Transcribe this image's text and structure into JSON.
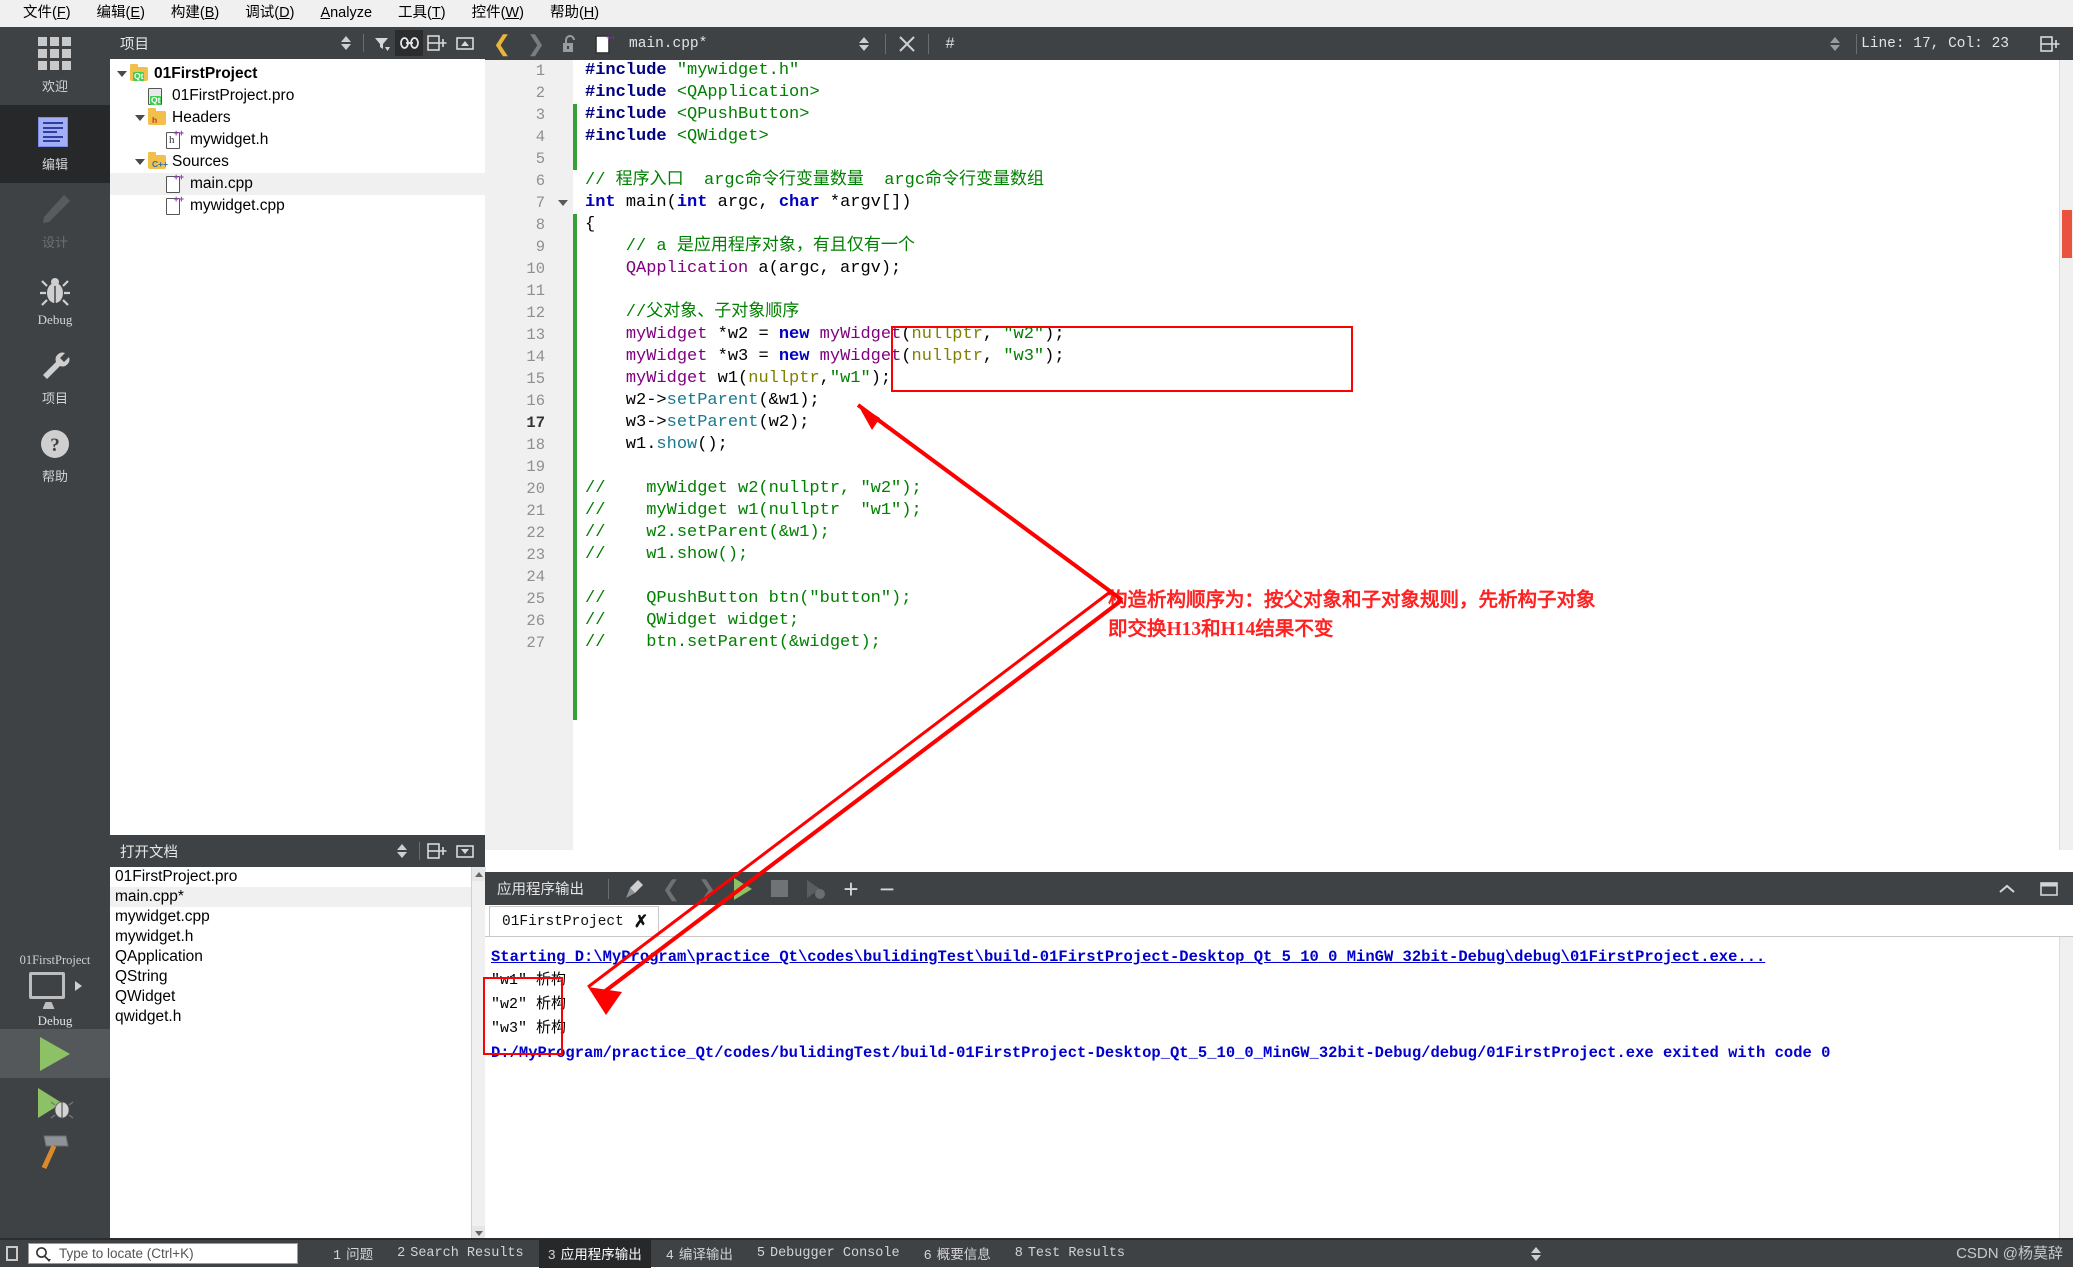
{
  "menu": {
    "items": [
      {
        "label": "文件(F)",
        "mnemonic": "F"
      },
      {
        "label": "编辑(E)",
        "mnemonic": "E"
      },
      {
        "label": "构建(B)",
        "mnemonic": "B"
      },
      {
        "label": "调试(D)",
        "mnemonic": "D"
      },
      {
        "label": "Analyze",
        "mnemonic": "A"
      },
      {
        "label": "工具(T)",
        "mnemonic": "T"
      },
      {
        "label": "控件(W)",
        "mnemonic": "W"
      },
      {
        "label": "帮助(H)",
        "mnemonic": "H"
      }
    ]
  },
  "modebar": {
    "items": [
      {
        "label": "欢迎",
        "icon": "grid-icon",
        "state": "normal"
      },
      {
        "label": "编辑",
        "icon": "edit-icon",
        "state": "selected"
      },
      {
        "label": "设计",
        "icon": "pencil-icon",
        "state": "disabled"
      },
      {
        "label": "Debug",
        "icon": "bug-icon",
        "state": "normal"
      },
      {
        "label": "项目",
        "icon": "wrench-icon",
        "state": "normal"
      },
      {
        "label": "帮助",
        "icon": "question-icon",
        "state": "normal"
      }
    ]
  },
  "project_panel": {
    "title": "项目",
    "toolbar_icons": [
      "sync-updown-icon",
      "filter-icon",
      "link-icon",
      "split-add-icon",
      "collapse-icon"
    ],
    "tree": [
      {
        "label": "01FirstProject",
        "indent": 0,
        "icon": "folder-qt-icon",
        "expander": "down",
        "bold": true,
        "selected": false
      },
      {
        "label": "01FirstProject.pro",
        "indent": 1,
        "icon": "file-qt-icon",
        "expander": "none",
        "bold": false,
        "selected": false
      },
      {
        "label": "Headers",
        "indent": 1,
        "icon": "folder-h-icon",
        "expander": "down",
        "bold": false,
        "selected": false
      },
      {
        "label": "mywidget.h",
        "indent": 2,
        "icon": "header-cpp-icon",
        "expander": "none",
        "bold": false,
        "selected": false
      },
      {
        "label": "Sources",
        "indent": 1,
        "icon": "folder-cpp-icon",
        "expander": "down",
        "bold": false,
        "selected": false
      },
      {
        "label": "main.cpp",
        "indent": 2,
        "icon": "source-cpp-icon",
        "expander": "none",
        "bold": false,
        "selected": true
      },
      {
        "label": "mywidget.cpp",
        "indent": 2,
        "icon": "source-cpp-icon",
        "expander": "none",
        "bold": false,
        "selected": false
      }
    ]
  },
  "docs_panel": {
    "title": "打开文档",
    "toolbar_icons": [
      "sync-updown-icon",
      "split-add-icon",
      "dropdown-icon"
    ],
    "items": [
      {
        "label": "01FirstProject.pro",
        "selected": false
      },
      {
        "label": "main.cpp*",
        "selected": true
      },
      {
        "label": "mywidget.cpp",
        "selected": false
      },
      {
        "label": "mywidget.h",
        "selected": false
      },
      {
        "label": "QApplication",
        "selected": false
      },
      {
        "label": "QString",
        "selected": false
      },
      {
        "label": "QWidget",
        "selected": false
      },
      {
        "label": "qwidget.h",
        "selected": false
      }
    ]
  },
  "kit_selector": {
    "project": "01FirstProject",
    "build_config": "Debug",
    "actions": [
      "run-button",
      "debug-button",
      "build-button"
    ]
  },
  "editor_toolbar": {
    "filename": "main.cpp*",
    "hash_symbol": "#",
    "line_col": "Line: 17, Col: 23",
    "icons": [
      "back-arrow-icon",
      "forward-arrow-icon",
      "unlock-icon",
      "file-cpp-icon",
      "updown-icon",
      "close-icon",
      "hash-icon",
      "split-add-icon"
    ]
  },
  "code": {
    "lines": [
      {
        "n": 1,
        "tokens": [
          {
            "t": "#include ",
            "c": "pp"
          },
          {
            "t": "\"mywidget.h\"",
            "c": "s"
          }
        ]
      },
      {
        "n": 2,
        "tokens": [
          {
            "t": "#include ",
            "c": "pp"
          },
          {
            "t": "<QApplication>",
            "c": "s"
          }
        ]
      },
      {
        "n": 3,
        "tokens": [
          {
            "t": "#include ",
            "c": "pp"
          },
          {
            "t": "<QPushButton>",
            "c": "s"
          }
        ]
      },
      {
        "n": 4,
        "tokens": [
          {
            "t": "#include ",
            "c": "pp"
          },
          {
            "t": "<QWidget>",
            "c": "s"
          }
        ]
      },
      {
        "n": 5,
        "tokens": []
      },
      {
        "n": 6,
        "tokens": [
          {
            "t": "// 程序入口  argc命令行变量数量  argc命令行变量数组",
            "c": "c"
          }
        ]
      },
      {
        "n": 7,
        "tokens": [
          {
            "t": "int",
            "c": "k"
          },
          {
            "t": " ",
            "c": "pl"
          },
          {
            "t": "main",
            "c": "pl"
          },
          {
            "t": "(",
            "c": "pl"
          },
          {
            "t": "int",
            "c": "k"
          },
          {
            "t": " argc, ",
            "c": "pl"
          },
          {
            "t": "char",
            "c": "k"
          },
          {
            "t": " *argv[])",
            "c": "pl"
          }
        ]
      },
      {
        "n": 8,
        "tokens": [
          {
            "t": "{",
            "c": "pl"
          }
        ]
      },
      {
        "n": 9,
        "tokens": [
          {
            "t": "    // a 是应用程序对象，有且仅有一个",
            "c": "c"
          }
        ]
      },
      {
        "n": 10,
        "tokens": [
          {
            "t": "    ",
            "c": "pl"
          },
          {
            "t": "QApplication",
            "c": "ty"
          },
          {
            "t": " a(argc, argv);",
            "c": "pl"
          }
        ]
      },
      {
        "n": 11,
        "tokens": []
      },
      {
        "n": 12,
        "tokens": [
          {
            "t": "    //父对象、子对象顺序",
            "c": "c"
          }
        ]
      },
      {
        "n": 13,
        "tokens": [
          {
            "t": "    ",
            "c": "pl"
          },
          {
            "t": "myWidget",
            "c": "ty"
          },
          {
            "t": " *w2 = ",
            "c": "pl"
          },
          {
            "t": "new",
            "c": "k"
          },
          {
            "t": " ",
            "c": "pl"
          },
          {
            "t": "myWidget",
            "c": "ty"
          },
          {
            "t": "(",
            "c": "pl"
          },
          {
            "t": "nullptr",
            "c": "np"
          },
          {
            "t": ", ",
            "c": "pl"
          },
          {
            "t": "\"w2\"",
            "c": "s"
          },
          {
            "t": ");",
            "c": "pl"
          }
        ]
      },
      {
        "n": 14,
        "tokens": [
          {
            "t": "    ",
            "c": "pl"
          },
          {
            "t": "myWidget",
            "c": "ty"
          },
          {
            "t": " *w3 = ",
            "c": "pl"
          },
          {
            "t": "new",
            "c": "k"
          },
          {
            "t": " ",
            "c": "pl"
          },
          {
            "t": "myWidget",
            "c": "ty"
          },
          {
            "t": "(",
            "c": "pl"
          },
          {
            "t": "nullptr",
            "c": "np"
          },
          {
            "t": ", ",
            "c": "pl"
          },
          {
            "t": "\"w3\"",
            "c": "s"
          },
          {
            "t": ");",
            "c": "pl"
          }
        ]
      },
      {
        "n": 15,
        "tokens": [
          {
            "t": "    ",
            "c": "pl"
          },
          {
            "t": "myWidget",
            "c": "ty"
          },
          {
            "t": " w1(",
            "c": "pl"
          },
          {
            "t": "nullptr",
            "c": "np"
          },
          {
            "t": ",",
            "c": "pl"
          },
          {
            "t": "\"w1\"",
            "c": "s"
          },
          {
            "t": ");",
            "c": "pl"
          }
        ]
      },
      {
        "n": 16,
        "tokens": [
          {
            "t": "    w2->",
            "c": "pl"
          },
          {
            "t": "setParent",
            "c": "fn"
          },
          {
            "t": "(&w1);",
            "c": "pl"
          }
        ]
      },
      {
        "n": 17,
        "tokens": [
          {
            "t": "    w3->",
            "c": "pl"
          },
          {
            "t": "setParent",
            "c": "fn"
          },
          {
            "t": "(w2);",
            "c": "pl"
          }
        ]
      },
      {
        "n": 18,
        "tokens": [
          {
            "t": "    w1.",
            "c": "pl"
          },
          {
            "t": "show",
            "c": "fn"
          },
          {
            "t": "();",
            "c": "pl"
          }
        ]
      },
      {
        "n": 19,
        "tokens": []
      },
      {
        "n": 20,
        "tokens": [
          {
            "t": "//    myWidget w2(nullptr, \"w2\");",
            "c": "c"
          }
        ]
      },
      {
        "n": 21,
        "tokens": [
          {
            "t": "//    myWidget w1(nullptr  \"w1\");",
            "c": "c"
          }
        ]
      },
      {
        "n": 22,
        "tokens": [
          {
            "t": "//    w2.setParent(&w1);",
            "c": "c"
          }
        ]
      },
      {
        "n": 23,
        "tokens": [
          {
            "t": "//    w1.show();",
            "c": "c"
          }
        ]
      },
      {
        "n": 24,
        "tokens": []
      },
      {
        "n": 25,
        "tokens": [
          {
            "t": "//    QPushButton btn(\"button\");",
            "c": "c"
          }
        ]
      },
      {
        "n": 26,
        "tokens": [
          {
            "t": "//    QWidget widget;",
            "c": "c"
          }
        ]
      },
      {
        "n": 27,
        "tokens": [
          {
            "t": "//    btn.setParent(&widget);",
            "c": "c"
          }
        ]
      }
    ],
    "current_line": 17
  },
  "annotation": {
    "line1": "构造析构顺序为：按父对象和子对象规则，先析构子对象",
    "line2": "即交换H13和H14结果不变",
    "color": "#ff0000"
  },
  "output_pane": {
    "title": "应用程序输出",
    "toolbar_icons": [
      "broom-icon",
      "prev-icon",
      "next-icon",
      "run-icon",
      "stop-icon",
      "rerun-icon",
      "plus-icon",
      "minus-icon"
    ],
    "corner_icons": [
      "collapse-up-icon",
      "maximize-icon"
    ],
    "tab": {
      "label": "01FirstProject",
      "close": "✗"
    },
    "lines": [
      {
        "text": "Starting D:\\MyProgram\\practice_Qt\\codes\\bulidingTest\\build-01FirstProject-Desktop_Qt_5_10_0_MinGW_32bit-Debug\\debug\\01FirstProject.exe...",
        "style": "link"
      },
      {
        "text": "\"w1\" 析构",
        "style": "app"
      },
      {
        "text": "\"w2\" 析构",
        "style": "app"
      },
      {
        "text": "\"w3\" 析构",
        "style": "app"
      },
      {
        "text": "D:/MyProgram/practice_Qt/codes/bulidingTest/build-01FirstProject-Desktop_Qt_5_10_0_MinGW_32bit-Debug/debug/01FirstProject.exe exited with code 0",
        "style": "link"
      }
    ]
  },
  "statusbar": {
    "locator_placeholder": "Type to locate (Ctrl+K)",
    "tabs": [
      {
        "num": "1",
        "label": "问题",
        "selected": false
      },
      {
        "num": "2",
        "label": "Search Results",
        "selected": false
      },
      {
        "num": "3",
        "label": "应用程序输出",
        "selected": true
      },
      {
        "num": "4",
        "label": "编译输出",
        "selected": false
      },
      {
        "num": "5",
        "label": "Debugger Console",
        "selected": false
      },
      {
        "num": "6",
        "label": "概要信息",
        "selected": false
      },
      {
        "num": "8",
        "label": "Test Results",
        "selected": false
      }
    ],
    "watermark": "CSDN @杨莫辞"
  },
  "colors": {
    "chrome_dark": "#3f4245",
    "chrome_selected": "#262829",
    "accent_green": "#8cc265",
    "annotation_red": "#ff0000",
    "output_blue": "#0000cc",
    "changebar_green": "#35a035"
  }
}
